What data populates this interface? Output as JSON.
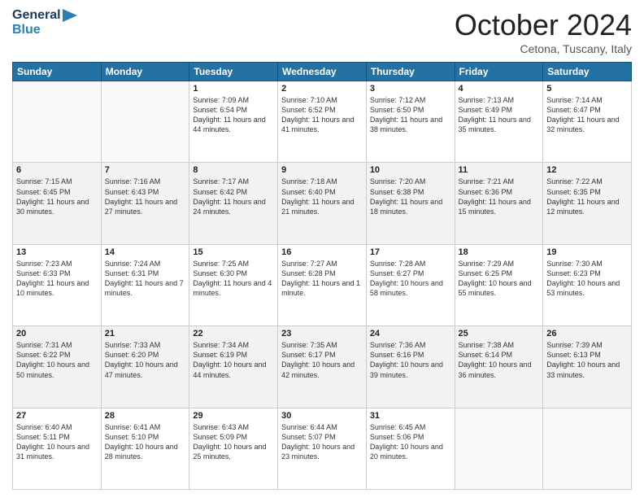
{
  "header": {
    "logo_general": "General",
    "logo_blue": "Blue",
    "month": "October 2024",
    "location": "Cetona, Tuscany, Italy"
  },
  "columns": [
    "Sunday",
    "Monday",
    "Tuesday",
    "Wednesday",
    "Thursday",
    "Friday",
    "Saturday"
  ],
  "weeks": [
    [
      {
        "day": "",
        "info": ""
      },
      {
        "day": "",
        "info": ""
      },
      {
        "day": "1",
        "info": "Sunrise: 7:09 AM\nSunset: 6:54 PM\nDaylight: 11 hours and 44 minutes."
      },
      {
        "day": "2",
        "info": "Sunrise: 7:10 AM\nSunset: 6:52 PM\nDaylight: 11 hours and 41 minutes."
      },
      {
        "day": "3",
        "info": "Sunrise: 7:12 AM\nSunset: 6:50 PM\nDaylight: 11 hours and 38 minutes."
      },
      {
        "day": "4",
        "info": "Sunrise: 7:13 AM\nSunset: 6:49 PM\nDaylight: 11 hours and 35 minutes."
      },
      {
        "day": "5",
        "info": "Sunrise: 7:14 AM\nSunset: 6:47 PM\nDaylight: 11 hours and 32 minutes."
      }
    ],
    [
      {
        "day": "6",
        "info": "Sunrise: 7:15 AM\nSunset: 6:45 PM\nDaylight: 11 hours and 30 minutes."
      },
      {
        "day": "7",
        "info": "Sunrise: 7:16 AM\nSunset: 6:43 PM\nDaylight: 11 hours and 27 minutes."
      },
      {
        "day": "8",
        "info": "Sunrise: 7:17 AM\nSunset: 6:42 PM\nDaylight: 11 hours and 24 minutes."
      },
      {
        "day": "9",
        "info": "Sunrise: 7:18 AM\nSunset: 6:40 PM\nDaylight: 11 hours and 21 minutes."
      },
      {
        "day": "10",
        "info": "Sunrise: 7:20 AM\nSunset: 6:38 PM\nDaylight: 11 hours and 18 minutes."
      },
      {
        "day": "11",
        "info": "Sunrise: 7:21 AM\nSunset: 6:36 PM\nDaylight: 11 hours and 15 minutes."
      },
      {
        "day": "12",
        "info": "Sunrise: 7:22 AM\nSunset: 6:35 PM\nDaylight: 11 hours and 12 minutes."
      }
    ],
    [
      {
        "day": "13",
        "info": "Sunrise: 7:23 AM\nSunset: 6:33 PM\nDaylight: 11 hours and 10 minutes."
      },
      {
        "day": "14",
        "info": "Sunrise: 7:24 AM\nSunset: 6:31 PM\nDaylight: 11 hours and 7 minutes."
      },
      {
        "day": "15",
        "info": "Sunrise: 7:25 AM\nSunset: 6:30 PM\nDaylight: 11 hours and 4 minutes."
      },
      {
        "day": "16",
        "info": "Sunrise: 7:27 AM\nSunset: 6:28 PM\nDaylight: 11 hours and 1 minute."
      },
      {
        "day": "17",
        "info": "Sunrise: 7:28 AM\nSunset: 6:27 PM\nDaylight: 10 hours and 58 minutes."
      },
      {
        "day": "18",
        "info": "Sunrise: 7:29 AM\nSunset: 6:25 PM\nDaylight: 10 hours and 55 minutes."
      },
      {
        "day": "19",
        "info": "Sunrise: 7:30 AM\nSunset: 6:23 PM\nDaylight: 10 hours and 53 minutes."
      }
    ],
    [
      {
        "day": "20",
        "info": "Sunrise: 7:31 AM\nSunset: 6:22 PM\nDaylight: 10 hours and 50 minutes."
      },
      {
        "day": "21",
        "info": "Sunrise: 7:33 AM\nSunset: 6:20 PM\nDaylight: 10 hours and 47 minutes."
      },
      {
        "day": "22",
        "info": "Sunrise: 7:34 AM\nSunset: 6:19 PM\nDaylight: 10 hours and 44 minutes."
      },
      {
        "day": "23",
        "info": "Sunrise: 7:35 AM\nSunset: 6:17 PM\nDaylight: 10 hours and 42 minutes."
      },
      {
        "day": "24",
        "info": "Sunrise: 7:36 AM\nSunset: 6:16 PM\nDaylight: 10 hours and 39 minutes."
      },
      {
        "day": "25",
        "info": "Sunrise: 7:38 AM\nSunset: 6:14 PM\nDaylight: 10 hours and 36 minutes."
      },
      {
        "day": "26",
        "info": "Sunrise: 7:39 AM\nSunset: 6:13 PM\nDaylight: 10 hours and 33 minutes."
      }
    ],
    [
      {
        "day": "27",
        "info": "Sunrise: 6:40 AM\nSunset: 5:11 PM\nDaylight: 10 hours and 31 minutes."
      },
      {
        "day": "28",
        "info": "Sunrise: 6:41 AM\nSunset: 5:10 PM\nDaylight: 10 hours and 28 minutes."
      },
      {
        "day": "29",
        "info": "Sunrise: 6:43 AM\nSunset: 5:09 PM\nDaylight: 10 hours and 25 minutes."
      },
      {
        "day": "30",
        "info": "Sunrise: 6:44 AM\nSunset: 5:07 PM\nDaylight: 10 hours and 23 minutes."
      },
      {
        "day": "31",
        "info": "Sunrise: 6:45 AM\nSunset: 5:06 PM\nDaylight: 10 hours and 20 minutes."
      },
      {
        "day": "",
        "info": ""
      },
      {
        "day": "",
        "info": ""
      }
    ]
  ]
}
